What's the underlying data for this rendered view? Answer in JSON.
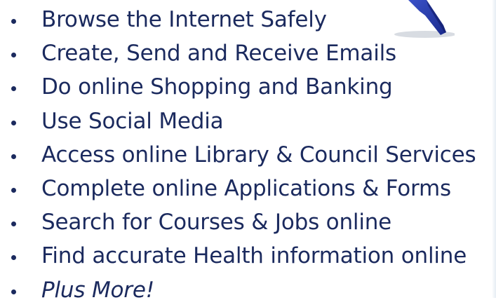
{
  "colors": {
    "text": "#1b2a5e",
    "cursor_fill": "#2438a8",
    "cursor_shadow": "#b8c0cc"
  },
  "icons": {
    "cursor": "mouse-pointer-arrow-icon"
  },
  "list": {
    "items": [
      {
        "label": "Browse the Internet Safely"
      },
      {
        "label": "Create, Send and Receive Emails"
      },
      {
        "label": "Do online Shopping and Banking"
      },
      {
        "label": "Use Social Media"
      },
      {
        "label": "Access online Library & Council Services"
      },
      {
        "label": "Complete online Applications & Forms"
      },
      {
        "label": "Search for Courses & Jobs online"
      },
      {
        "label": "Find accurate Health information online"
      },
      {
        "label": "Plus More!"
      }
    ]
  }
}
